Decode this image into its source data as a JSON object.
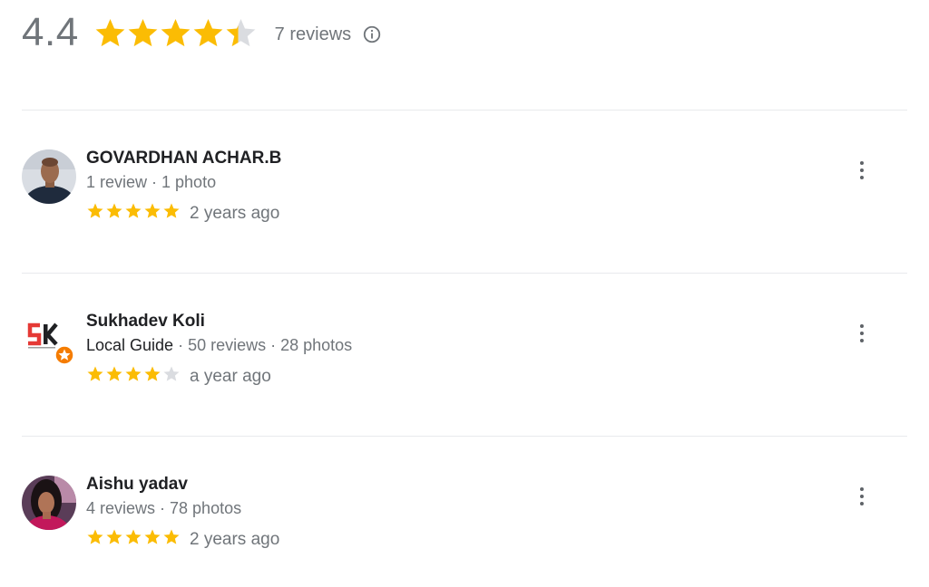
{
  "summary": {
    "rating": "4.4",
    "rating_value": 4.4,
    "stars_out_of": 5,
    "reviews_count": "7 reviews",
    "info_icon": "info-icon"
  },
  "reviews": [
    {
      "name": "GOVARDHAN ACHAR.B",
      "local_guide": "",
      "meta": "1 review · 1 photo",
      "rating": 5,
      "date": "2 years ago",
      "avatar": "person-photo-avatar"
    },
    {
      "name": "Sukhadev Koli",
      "local_guide": "Local Guide",
      "meta": " · 50 reviews · 28 photos",
      "rating": 4,
      "date": "a year ago",
      "avatar": "sk-logo-avatar"
    },
    {
      "name": "Aishu yadav",
      "local_guide": "",
      "meta": "4 reviews · 78 photos",
      "rating": 5,
      "date": "2 years ago",
      "avatar": "person-photo-avatar"
    }
  ],
  "colors": {
    "star_filled": "#fbbc04",
    "star_empty": "#dadce0",
    "muted_text": "#70757a",
    "name_text": "#202124",
    "divider": "#e8eaed"
  }
}
